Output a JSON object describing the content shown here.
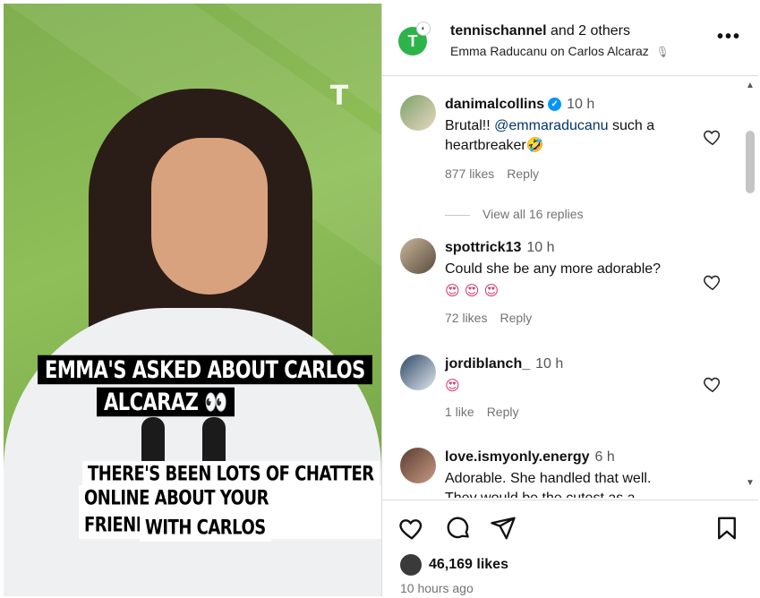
{
  "media": {
    "caption_line1": "EMMA'S ASKED ABOUT CARLOS",
    "caption_line2": "ALCARAZ 👀",
    "caption2_line1": "THERE'S BEEN LOTS OF CHATTER",
    "caption2_line2": "ONLINE ABOUT YOUR FRIENDSHIP",
    "caption2_line3": "WITH CARLOS",
    "brand_mark": "T"
  },
  "header": {
    "username": "tennischannel",
    "others": "and 2 others",
    "subtitle": "Emma Raducanu on Carlos Alcaraz",
    "avatar_letter": "T"
  },
  "comments": [
    {
      "username": "danimalcollins",
      "verified": true,
      "time": "10 h",
      "text_pre": "Brutal!! ",
      "mention": "@emmaraducanu",
      "text_post": " such a heartbreaker🤣",
      "likes": "877 likes",
      "reply": "Reply",
      "view_replies": "View all 16 replies"
    },
    {
      "username": "spottrick13",
      "time": "10 h",
      "text": "Could she be any more adorable?",
      "emoji": "😍 😍 😍",
      "likes": "72 likes",
      "reply": "Reply"
    },
    {
      "username": "jordiblanch_",
      "time": "10 h",
      "emoji": "😍",
      "likes": "1 like",
      "reply": "Reply"
    },
    {
      "username": "love.ismyonly.energy",
      "time": "6 h",
      "text": "Adorable. She handled that well.",
      "text2": "They would be the cutest as a"
    }
  ],
  "footer": {
    "likes": "46,169 likes",
    "time_ago": "10 hours ago"
  },
  "colors": {
    "mention": "#00376b",
    "verified": "#0095f6",
    "brand_green": "#2db34a"
  }
}
